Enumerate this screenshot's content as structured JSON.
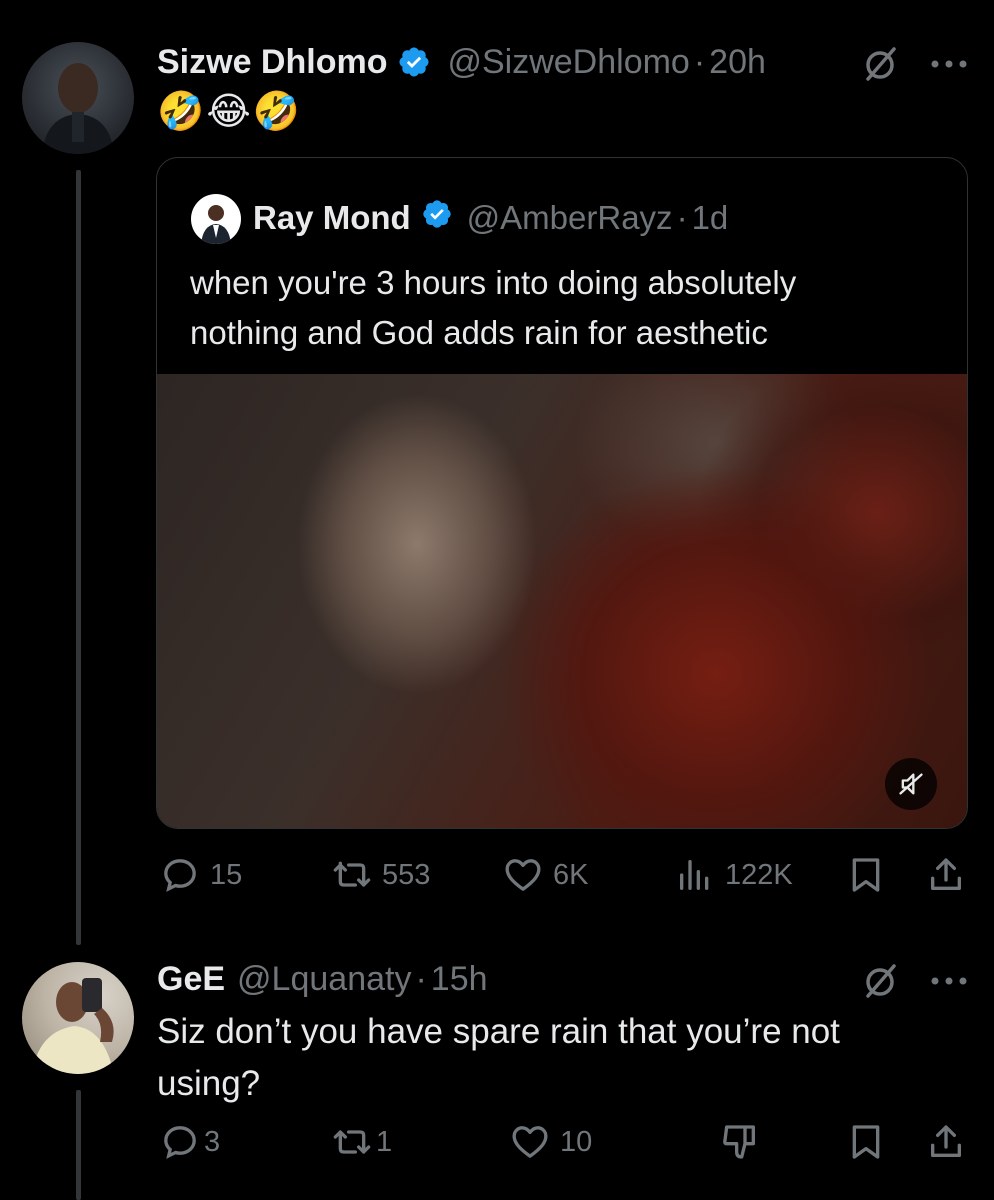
{
  "tweet": {
    "author_name": "Sizwe Dhlomo",
    "handle": "@SizweDhlomo",
    "separator": "·",
    "time": "20h",
    "text": "🤣😂🤣",
    "quote": {
      "author_name": "Ray Mond",
      "handle": "@AmberRayz",
      "separator": "·",
      "time": "1d",
      "text_line1": "when you're 3 hours into doing absolutely",
      "text_line2": "nothing and God adds rain for aesthetic"
    },
    "actions": {
      "replies": "15",
      "reposts": "553",
      "likes": "6K",
      "views": "122K"
    }
  },
  "reply": {
    "author_name": "GeE",
    "handle": "@Lquanaty",
    "separator": "·",
    "time": "15h",
    "text_line1": "Siz don’t you have spare rain that you’re not",
    "text_line2": "using?",
    "actions": {
      "replies": "3",
      "reposts": "1",
      "likes": "10"
    }
  },
  "colors": {
    "background": "#000000",
    "verified": "#1d9bf0",
    "muted": "#71767b",
    "text": "#e7e9ea",
    "border": "#2f3336"
  },
  "icons": [
    "verified-badge-icon",
    "grok-icon",
    "more-icon",
    "reply-icon",
    "repost-icon",
    "like-icon",
    "views-icon",
    "bookmark-icon",
    "share-icon",
    "downvote-icon",
    "mute-icon"
  ]
}
